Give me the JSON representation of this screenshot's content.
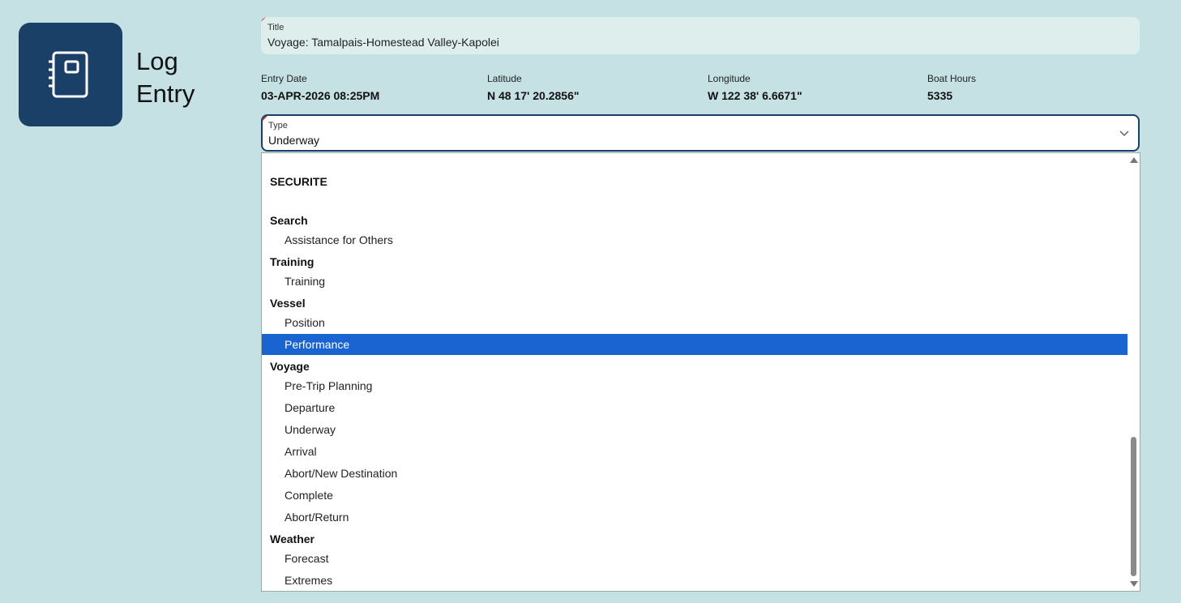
{
  "app": {
    "icon": "notebook-icon",
    "title": "Log\nEntry"
  },
  "title_field": {
    "label": "Title",
    "value": "Voyage: Tamalpais-Homestead Valley-Kapolei"
  },
  "info": {
    "entry_date": {
      "label": "Entry Date",
      "value": "03-APR-2026 08:25PM"
    },
    "latitude": {
      "label": "Latitude",
      "value": "N 48 17' 20.2856\""
    },
    "longitude": {
      "label": "Longitude",
      "value": "W 122 38' 6.6671\""
    },
    "boat_hours": {
      "label": "Boat Hours",
      "value": "5335"
    }
  },
  "type_select": {
    "label": "Type",
    "value": "Underway",
    "chevron_icon": "chevron-down-icon"
  },
  "dropdown": {
    "items": [
      {
        "kind": "header",
        "label": "SECURITE"
      },
      {
        "kind": "header",
        "label": "Search"
      },
      {
        "kind": "item",
        "label": "Assistance for Others"
      },
      {
        "kind": "header",
        "label": "Training"
      },
      {
        "kind": "item",
        "label": "Training"
      },
      {
        "kind": "header",
        "label": "Vessel"
      },
      {
        "kind": "item",
        "label": "Position"
      },
      {
        "kind": "item",
        "label": "Performance",
        "selected": true
      },
      {
        "kind": "header",
        "label": "Voyage"
      },
      {
        "kind": "item",
        "label": "Pre-Trip Planning"
      },
      {
        "kind": "item",
        "label": "Departure"
      },
      {
        "kind": "item",
        "label": "Underway"
      },
      {
        "kind": "item",
        "label": "Arrival"
      },
      {
        "kind": "item",
        "label": "Abort/New Destination"
      },
      {
        "kind": "item",
        "label": "Complete"
      },
      {
        "kind": "item",
        "label": "Abort/Return"
      },
      {
        "kind": "header",
        "label": "Weather"
      },
      {
        "kind": "item",
        "label": "Forecast"
      },
      {
        "kind": "item",
        "label": "Extremes"
      }
    ],
    "selected_color": "#1a64d1"
  },
  "colors": {
    "background": "#c5e1e4",
    "brand": "#1b4068",
    "required_marker": "#c62828"
  }
}
